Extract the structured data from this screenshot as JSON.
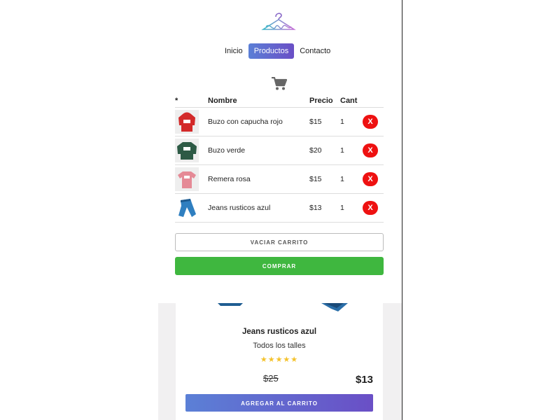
{
  "brand": {
    "logo_text": "fashion",
    "colors": {
      "gradient_start": "#5b80d6",
      "gradient_end": "#6a4fc6"
    }
  },
  "nav": {
    "items": [
      {
        "label": "Inicio",
        "active": false
      },
      {
        "label": "Productos",
        "active": true
      },
      {
        "label": "Contacto",
        "active": false
      }
    ]
  },
  "cart": {
    "icon": "shopping-cart-icon",
    "headers": {
      "image": "*",
      "name": "Nombre",
      "price": "Precio",
      "qty": "Cant"
    },
    "items": [
      {
        "image": "red-hoodie",
        "name": "Buzo con capucha rojo",
        "price": "$15",
        "qty": "1",
        "delete": "X"
      },
      {
        "image": "green-sweater",
        "name": "Buzo verde",
        "price": "$20",
        "qty": "1",
        "delete": "X"
      },
      {
        "image": "pink-tshirt",
        "name": "Remera rosa",
        "price": "$15",
        "qty": "1",
        "delete": "X"
      },
      {
        "image": "blue-jeans",
        "name": "Jeans rusticos azul",
        "price": "$13",
        "qty": "1",
        "delete": "X"
      }
    ],
    "empty_label": "VACIAR CARRITO",
    "buy_label": "COMPRAR",
    "buy_color": "#3fb73f",
    "delete_color": "#ee1111"
  },
  "product": {
    "title": "Jeans rusticos azul",
    "subtitle": "Todos los talles",
    "stars": "★★★★★",
    "rating": 5,
    "old_price": "$25",
    "price": "$13",
    "add_label": "AGREGAR AL CARRITO"
  }
}
